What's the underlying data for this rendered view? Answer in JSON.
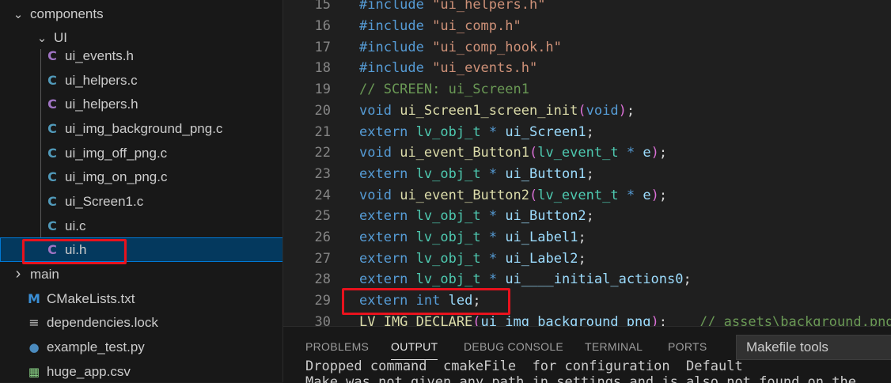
{
  "explorer": {
    "items": [
      {
        "label": "components",
        "icon": "chevron-down-icon",
        "type": "folder"
      },
      {
        "label": "UI",
        "icon": "chevron-down-icon",
        "type": "folder"
      },
      {
        "label": "ui_events.h",
        "icon": "c-header-icon",
        "glyph": "C"
      },
      {
        "label": "ui_helpers.c",
        "icon": "c-file-icon",
        "glyph": "C"
      },
      {
        "label": "ui_helpers.h",
        "icon": "c-header-icon",
        "glyph": "C"
      },
      {
        "label": "ui_img_background_png.c",
        "icon": "c-file-icon",
        "glyph": "C"
      },
      {
        "label": "ui_img_off_png.c",
        "icon": "c-file-icon",
        "glyph": "C"
      },
      {
        "label": "ui_img_on_png.c",
        "icon": "c-file-icon",
        "glyph": "C"
      },
      {
        "label": "ui_Screen1.c",
        "icon": "c-file-icon",
        "glyph": "C"
      },
      {
        "label": "ui.c",
        "icon": "c-file-icon",
        "glyph": "C"
      },
      {
        "label": "ui.h",
        "icon": "c-header-icon",
        "glyph": "C",
        "selected": true
      },
      {
        "label": "main",
        "icon": "chevron-right-icon",
        "type": "folder"
      },
      {
        "label": "CMakeLists.txt",
        "icon": "cmake-icon",
        "glyph": "M"
      },
      {
        "label": "dependencies.lock",
        "icon": "lines-icon",
        "glyph": "≡"
      },
      {
        "label": "example_test.py",
        "icon": "python-icon",
        "glyph": "●"
      },
      {
        "label": "huge_app.csv",
        "icon": "csv-icon",
        "glyph": "▦"
      }
    ]
  },
  "editor": {
    "lines": [
      {
        "n": "15",
        "text": "#include \"ui_helpers.h\""
      },
      {
        "n": "16",
        "text": "#include \"ui_comp.h\""
      },
      {
        "n": "17",
        "text": "#include \"ui_comp_hook.h\""
      },
      {
        "n": "18",
        "text": "#include \"ui_events.h\""
      },
      {
        "n": "19",
        "text": "// SCREEN: ui_Screen1"
      },
      {
        "n": "20",
        "text": "void ui_Screen1_screen_init(void);"
      },
      {
        "n": "21",
        "text": "extern lv_obj_t * ui_Screen1;"
      },
      {
        "n": "22",
        "text": "void ui_event_Button1(lv_event_t * e);"
      },
      {
        "n": "23",
        "text": "extern lv_obj_t * ui_Button1;"
      },
      {
        "n": "24",
        "text": "void ui_event_Button2(lv_event_t * e);"
      },
      {
        "n": "25",
        "text": "extern lv_obj_t * ui_Button2;"
      },
      {
        "n": "26",
        "text": "extern lv_obj_t * ui_Label1;"
      },
      {
        "n": "27",
        "text": "extern lv_obj_t * ui_Label2;"
      },
      {
        "n": "28",
        "text": "extern lv_obj_t * ui____initial_actions0;"
      },
      {
        "n": "29",
        "text": "extern int led;"
      },
      {
        "n": "30",
        "text": "LV_IMG_DECLARE(ui_img_background_png);    // assets\\background.png"
      }
    ]
  },
  "panel": {
    "tabs": [
      "PROBLEMS",
      "OUTPUT",
      "DEBUG CONSOLE",
      "TERMINAL",
      "PORTS"
    ],
    "active_tab": "OUTPUT",
    "dropdown_value": "Makefile tools",
    "output_lines": [
      "Dropped command  cmakeFile  for configuration  Default",
      "Make was not given any path in settings and is also not found on the"
    ]
  },
  "colors": {
    "highlight_box": "#e8121d",
    "selection": "#04395e"
  }
}
